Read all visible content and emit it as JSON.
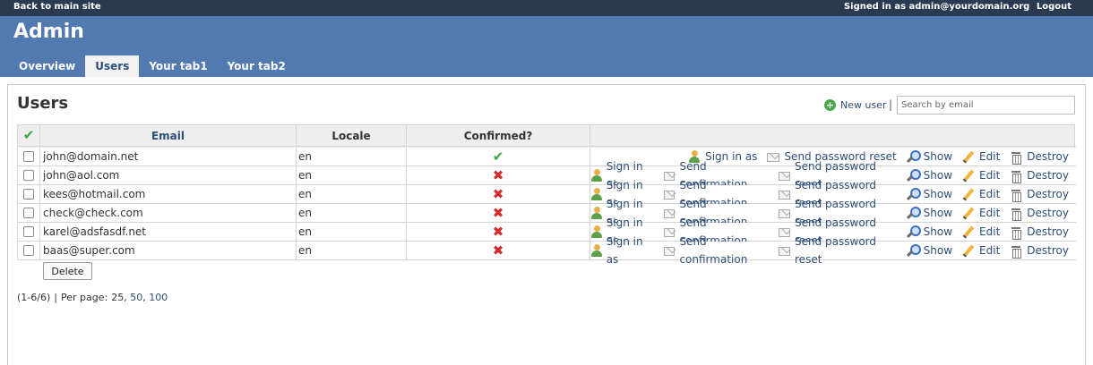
{
  "topbar": {
    "back_link": "Back to main site",
    "signed_in": "Signed in as admin@yourdomain.org",
    "logout": "Logout"
  },
  "header": {
    "title": "Admin",
    "tabs": [
      {
        "label": "Overview",
        "active": false
      },
      {
        "label": "Users",
        "active": true
      },
      {
        "label": "Your tab1",
        "active": false
      },
      {
        "label": "Your tab2",
        "active": false
      }
    ]
  },
  "page": {
    "title": "Users",
    "new_user": "New user",
    "separator": "|",
    "search_placeholder": "Search by email"
  },
  "table": {
    "headers": {
      "select_all": "✔",
      "email": "Email",
      "locale": "Locale",
      "confirmed": "Confirmed?"
    },
    "actions": {
      "sign_in": "Sign in as",
      "send_confirmation": "Send confirmation",
      "send_password_reset": "Send password reset",
      "show": "Show",
      "edit": "Edit",
      "destroy": "Destroy"
    },
    "rows": [
      {
        "email": "john@domain.net",
        "locale": "en",
        "confirmed": true,
        "confirmed_mark": "✔"
      },
      {
        "email": "john@aol.com",
        "locale": "en",
        "confirmed": false,
        "confirmed_mark": "✖"
      },
      {
        "email": "kees@hotmail.com",
        "locale": "en",
        "confirmed": false,
        "confirmed_mark": "✖"
      },
      {
        "email": "check@check.com",
        "locale": "en",
        "confirmed": false,
        "confirmed_mark": "✖"
      },
      {
        "email": "karel@adsfasdf.net",
        "locale": "en",
        "confirmed": false,
        "confirmed_mark": "✖"
      },
      {
        "email": "baas@super.com",
        "locale": "en",
        "confirmed": false,
        "confirmed_mark": "✖"
      }
    ],
    "delete_button": "Delete"
  },
  "pager": {
    "range": "(1-6/6)",
    "sep": "|",
    "per_page_label": "Per page:",
    "current": "25",
    "options": [
      "50",
      "100"
    ]
  },
  "colors": {
    "topbar": "#2a3a50",
    "header": "#527ab0",
    "link": "#2d4e78",
    "ok": "#3aa53a",
    "no": "#d42a2a"
  }
}
